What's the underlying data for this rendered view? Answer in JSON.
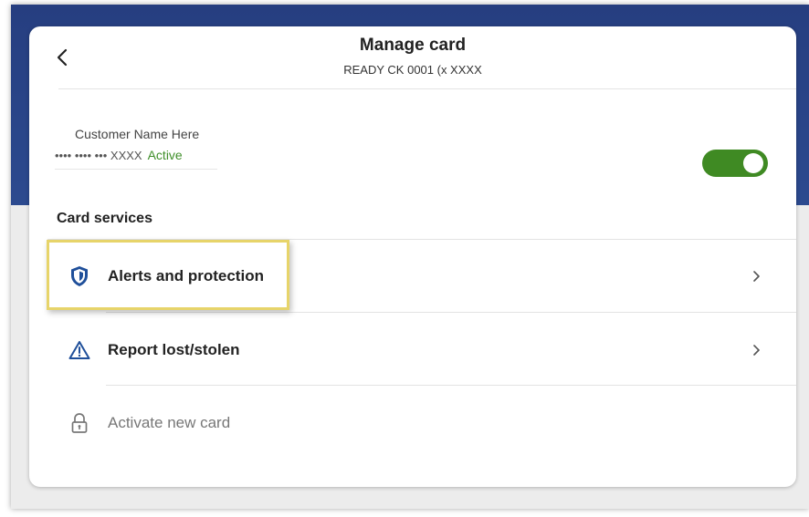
{
  "header": {
    "title": "Manage card",
    "subtitle": "READY CK 0001 (x XXXX",
    "back_icon": "chevron-left-icon"
  },
  "card_info": {
    "customer_name": "Customer Name Here",
    "masked_number": "•••• •••• ••• XXXX",
    "status": "Active",
    "toggle_on": true
  },
  "services": {
    "title": "Card services",
    "items": [
      {
        "label": "Alerts and protection",
        "icon": "shield-icon",
        "enabled": true
      },
      {
        "label": "Report lost/stolen",
        "icon": "warning-icon",
        "enabled": true
      },
      {
        "label": "Activate new card",
        "icon": "lock-icon",
        "enabled": false
      }
    ]
  },
  "colors": {
    "banner": "#263e80",
    "toggle": "#3f8a23",
    "status": "#3f8f2a",
    "highlight": "#e7d46a",
    "shield": "#1f4f9a"
  }
}
